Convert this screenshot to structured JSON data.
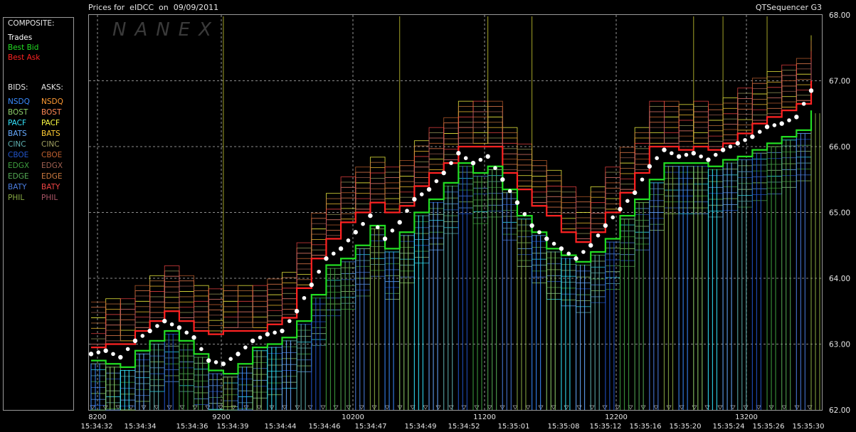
{
  "header": {
    "title": "Prices for  eIDCC  on  09/09/2011",
    "app": "QTSequencer G3"
  },
  "watermark": "NANEX",
  "legend": {
    "composite_label": "COMPOSITE:",
    "composite": [
      {
        "label": "Trades",
        "color": "#ffffff"
      },
      {
        "label": "Best Bid",
        "color": "#22dd22"
      },
      {
        "label": "Best Ask",
        "color": "#ff2222"
      }
    ],
    "bids_label": "BIDS:",
    "asks_label": "ASKS:",
    "bids": [
      {
        "label": "NSDQ",
        "color": "#3a8cff"
      },
      {
        "label": "BOST",
        "color": "#8fcf6a"
      },
      {
        "label": "PACF",
        "color": "#33e6ff"
      },
      {
        "label": "BATS",
        "color": "#66aaff"
      },
      {
        "label": "CINC",
        "color": "#5fb0b0"
      },
      {
        "label": "CBOE",
        "color": "#2255cc"
      },
      {
        "label": "EDGX",
        "color": "#3fa040"
      },
      {
        "label": "EDGE",
        "color": "#55aa55"
      },
      {
        "label": "BATY",
        "color": "#4a7de0"
      },
      {
        "label": "PHIL",
        "color": "#88aa44"
      }
    ],
    "asks": [
      {
        "label": "NSDQ",
        "color": "#ff9a33"
      },
      {
        "label": "BOST",
        "color": "#ff8855"
      },
      {
        "label": "PACF",
        "color": "#ffff44"
      },
      {
        "label": "BATS",
        "color": "#ffcc33"
      },
      {
        "label": "CINC",
        "color": "#a0a060"
      },
      {
        "label": "CBOE",
        "color": "#c06030"
      },
      {
        "label": "EDGX",
        "color": "#a06050"
      },
      {
        "label": "EDGE",
        "color": "#cc7a40"
      },
      {
        "label": "BATY",
        "color": "#ee4444"
      },
      {
        "label": "PHIL",
        "color": "#aa5566"
      }
    ]
  },
  "chart_data": {
    "type": "line",
    "title": "Prices for  eIDCC  on  09/09/2011",
    "ylim": [
      62.0,
      68.0
    ],
    "y_ticks": [
      "62.00",
      "63.00",
      "64.00",
      "65.00",
      "66.00",
      "67.00",
      "68.00"
    ],
    "x_seq_ticks": [
      "8200",
      "9200",
      "10200",
      "11200",
      "12200",
      "13200"
    ],
    "x_time_ticks": [
      "15:34:32",
      "15:34:34",
      "15:34:36",
      "15:34:39",
      "15:34:44",
      "15:34:46",
      "15:34:47",
      "15:34:49",
      "15:34:52",
      "15:35:01",
      "15:35:08",
      "15:35:12",
      "15:35:16",
      "15:35:20",
      "15:35:24",
      "15:35:26",
      "15:35:30"
    ],
    "grid": true,
    "series": [
      {
        "name": "Trades",
        "x": [
          0,
          1,
          2,
          3,
          4,
          5,
          6,
          7,
          8,
          9,
          10,
          11,
          12,
          13,
          14,
          15,
          16,
          17,
          18,
          19,
          20,
          21,
          22,
          23,
          24,
          25,
          26,
          27,
          28,
          29,
          30,
          31,
          32,
          33,
          34,
          35,
          36,
          37,
          38,
          39,
          40,
          41,
          42,
          43,
          44,
          45,
          46,
          47,
          48,
          49
        ],
        "y": [
          62.85,
          62.9,
          62.8,
          63.05,
          63.2,
          63.35,
          63.25,
          63.1,
          62.75,
          62.7,
          62.85,
          63.05,
          63.15,
          63.2,
          63.5,
          63.9,
          64.3,
          64.45,
          64.7,
          64.95,
          64.6,
          64.85,
          65.2,
          65.35,
          65.6,
          65.9,
          65.75,
          65.85,
          65.5,
          65.15,
          64.8,
          64.6,
          64.45,
          64.3,
          64.5,
          64.8,
          65.05,
          65.3,
          65.7,
          65.95,
          65.85,
          65.9,
          65.8,
          65.95,
          66.05,
          66.15,
          66.3,
          66.35,
          66.45,
          66.85
        ]
      },
      {
        "name": "Best Bid",
        "x": [
          0,
          1,
          2,
          3,
          4,
          5,
          6,
          7,
          8,
          9,
          10,
          11,
          12,
          13,
          14,
          15,
          16,
          17,
          18,
          19,
          20,
          21,
          22,
          23,
          24,
          25,
          26,
          27,
          28,
          29,
          30,
          31,
          32,
          33,
          34,
          35,
          36,
          37,
          38,
          39,
          40,
          41,
          42,
          43,
          44,
          45,
          46,
          47,
          48,
          49
        ],
        "y": [
          62.75,
          62.7,
          62.65,
          62.9,
          63.05,
          63.2,
          63.05,
          62.85,
          62.6,
          62.55,
          62.7,
          62.95,
          63.0,
          63.1,
          63.35,
          63.75,
          64.2,
          64.3,
          64.5,
          64.8,
          64.45,
          64.7,
          65.0,
          65.2,
          65.45,
          65.75,
          65.6,
          65.7,
          65.35,
          64.95,
          64.7,
          64.45,
          64.35,
          64.25,
          64.4,
          64.6,
          64.95,
          65.2,
          65.5,
          65.75,
          65.75,
          65.75,
          65.7,
          65.8,
          65.85,
          65.95,
          66.05,
          66.15,
          66.25,
          66.55
        ]
      },
      {
        "name": "Best Ask",
        "x": [
          0,
          1,
          2,
          3,
          4,
          5,
          6,
          7,
          8,
          9,
          10,
          11,
          12,
          13,
          14,
          15,
          16,
          17,
          18,
          19,
          20,
          21,
          22,
          23,
          24,
          25,
          26,
          27,
          28,
          29,
          30,
          31,
          32,
          33,
          34,
          35,
          36,
          37,
          38,
          39,
          40,
          41,
          42,
          43,
          44,
          45,
          46,
          47,
          48,
          49
        ],
        "y": [
          62.95,
          63.0,
          63.0,
          63.2,
          63.35,
          63.5,
          63.35,
          63.2,
          63.15,
          63.2,
          63.2,
          63.2,
          63.3,
          63.4,
          63.85,
          64.3,
          64.6,
          64.85,
          65.0,
          65.15,
          65.0,
          65.1,
          65.4,
          65.6,
          65.75,
          66.0,
          66.0,
          66.0,
          65.6,
          65.35,
          65.1,
          64.95,
          64.7,
          64.55,
          64.7,
          65.0,
          65.3,
          65.6,
          66.0,
          66.0,
          65.95,
          66.0,
          65.95,
          66.05,
          66.2,
          66.35,
          66.45,
          66.55,
          66.65,
          67.0
        ]
      }
    ]
  }
}
